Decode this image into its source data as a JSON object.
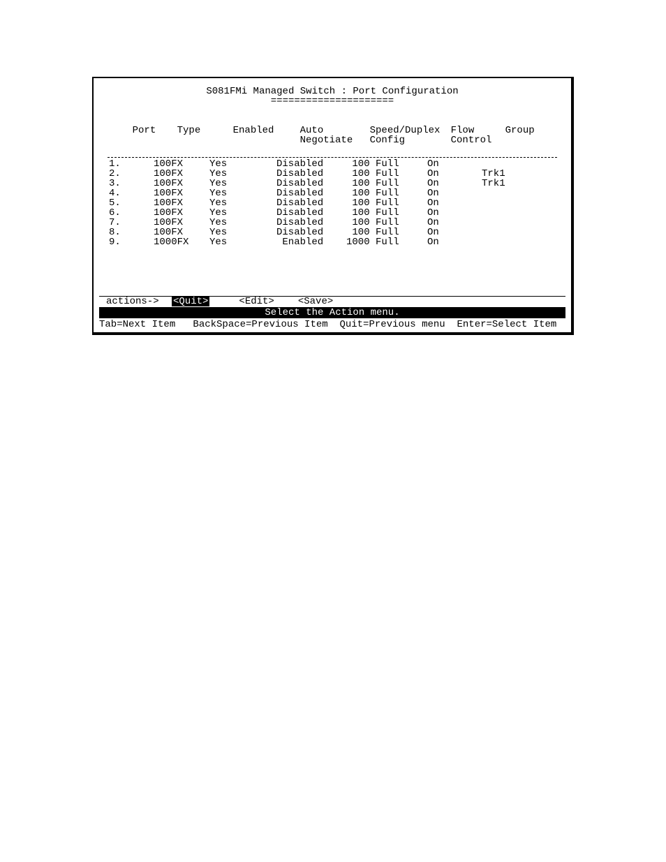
{
  "title": {
    "device": "S081FMi Managed Switch",
    "page": "Port Configuration",
    "sep": ":"
  },
  "underline": "=====================",
  "headers": {
    "port": "Port",
    "type": "Type",
    "enabled": "Enabled",
    "neg1": "Auto",
    "neg2": "Negotiate",
    "spd1": "Speed/Duplex",
    "spd2": "Config",
    "flow1": "Flow",
    "flow2": "Control",
    "group": "Group"
  },
  "rows": [
    {
      "port": "1.",
      "type": "100FX",
      "en": "Yes",
      "neg": "Disabled",
      "spd": " 100 Full",
      "flow": "On",
      "grp": ""
    },
    {
      "port": "2.",
      "type": "100FX",
      "en": "Yes",
      "neg": "Disabled",
      "spd": " 100 Full",
      "flow": "On",
      "grp": "Trk1"
    },
    {
      "port": "3.",
      "type": "100FX",
      "en": "Yes",
      "neg": "Disabled",
      "spd": " 100 Full",
      "flow": "On",
      "grp": "Trk1"
    },
    {
      "port": "4.",
      "type": "100FX",
      "en": "Yes",
      "neg": "Disabled",
      "spd": " 100 Full",
      "flow": "On",
      "grp": ""
    },
    {
      "port": "5.",
      "type": "100FX",
      "en": "Yes",
      "neg": "Disabled",
      "spd": " 100 Full",
      "flow": "On",
      "grp": ""
    },
    {
      "port": "6.",
      "type": "100FX",
      "en": "Yes",
      "neg": "Disabled",
      "spd": " 100 Full",
      "flow": "On",
      "grp": ""
    },
    {
      "port": "7.",
      "type": "100FX",
      "en": "Yes",
      "neg": "Disabled",
      "spd": " 100 Full",
      "flow": "On",
      "grp": ""
    },
    {
      "port": "8.",
      "type": "100FX",
      "en": "Yes",
      "neg": "Disabled",
      "spd": " 100 Full",
      "flow": "On",
      "grp": ""
    },
    {
      "port": "9.",
      "type": "1000FX",
      "en": "Yes",
      "neg": " Enabled",
      "spd": "1000 Full",
      "flow": "On",
      "grp": ""
    }
  ],
  "actions": {
    "label": "actions->",
    "quit": "<Quit>",
    "edit": "<Edit>",
    "save": "<Save>"
  },
  "hint": "Select the Action menu.",
  "help": "Tab=Next Item   BackSpace=Previous Item  Quit=Previous menu  Enter=Select Item"
}
